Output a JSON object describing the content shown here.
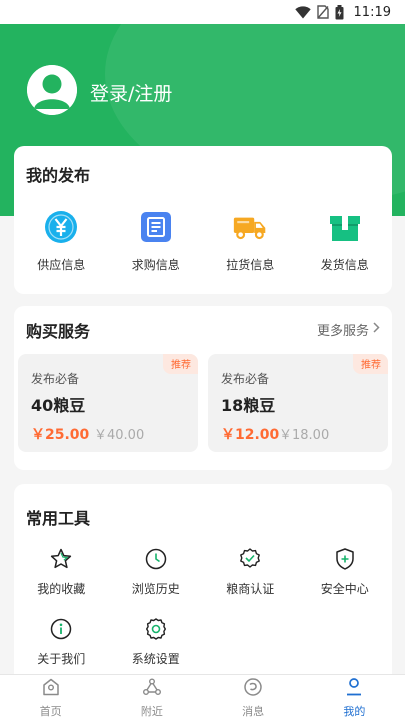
{
  "status_bar": {
    "time": "11:19"
  },
  "header": {
    "login_text": "登录/注册"
  },
  "my_publish": {
    "title": "我的发布",
    "items": [
      {
        "label": "供应信息",
        "icon": "yen-coin-icon",
        "color": "#19b0ec"
      },
      {
        "label": "求购信息",
        "icon": "document-list-icon",
        "color": "#4a83f0"
      },
      {
        "label": "拉货信息",
        "icon": "truck-icon",
        "color": "#f6a822"
      },
      {
        "label": "发货信息",
        "icon": "package-box-icon",
        "color": "#16c082"
      }
    ]
  },
  "buy_service": {
    "title": "购买服务",
    "more_label": "更多服务",
    "packages": [
      {
        "tag": "推荐",
        "subtitle": "发布必备",
        "name": "40粮豆",
        "price": "￥25.00",
        "original_price": "￥40.00"
      },
      {
        "tag": "推荐",
        "subtitle": "发布必备",
        "name": "18粮豆",
        "price": "￥12.00",
        "original_price": "￥18.00"
      }
    ]
  },
  "tools": {
    "title": "常用工具",
    "items": [
      {
        "label": "我的收藏",
        "icon": "star-icon"
      },
      {
        "label": "浏览历史",
        "icon": "clock-icon"
      },
      {
        "label": "粮商认证",
        "icon": "verified-badge-icon"
      },
      {
        "label": "安全中心",
        "icon": "shield-plus-icon"
      },
      {
        "label": "关于我们",
        "icon": "info-icon"
      },
      {
        "label": "系统设置",
        "icon": "settings-gear-icon"
      }
    ]
  },
  "tabbar": {
    "items": [
      {
        "label": "首页",
        "icon": "home-icon",
        "active": false
      },
      {
        "label": "附近",
        "icon": "nearby-nodes-icon",
        "active": false
      },
      {
        "label": "消息",
        "icon": "message-icon",
        "active": false
      },
      {
        "label": "我的",
        "icon": "profile-icon",
        "active": true
      }
    ]
  },
  "colors": {
    "brand_green": "#23b35f",
    "price_orange": "#ff6a33",
    "tab_active_blue": "#1f6fd1"
  }
}
